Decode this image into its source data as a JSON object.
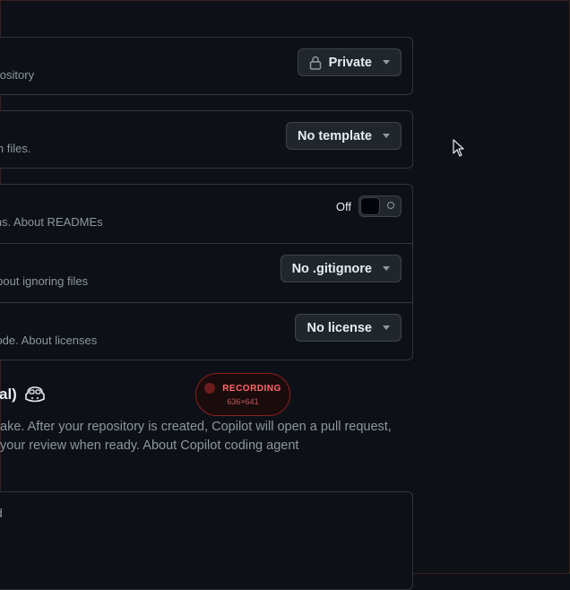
{
  "visibility": {
    "description": "repository",
    "button_label": "Private"
  },
  "template": {
    "description": "with files.",
    "button_label": "No template"
  },
  "readme": {
    "description": "tions. About READMEs",
    "toggle_label": "Off"
  },
  "gitignore": {
    "description": ". About ignoring files",
    "button_label": "No .gitignore"
  },
  "license": {
    "description": "r code. About licenses",
    "button_label": "No license"
  },
  "copilot": {
    "title": "al)",
    "description_line1": "ake. After your repository is created, Copilot will open a pull request,",
    "description_line2": " your review when ready. About Copilot coding agent"
  },
  "prompt": {
    "text": "uild"
  },
  "recording": {
    "label": "RECORDING",
    "dimensions": "636×641"
  },
  "colors": {
    "background": "#0d1117",
    "border": "#30363d",
    "button_bg": "#21262d",
    "recording": "#ff6b6b"
  }
}
